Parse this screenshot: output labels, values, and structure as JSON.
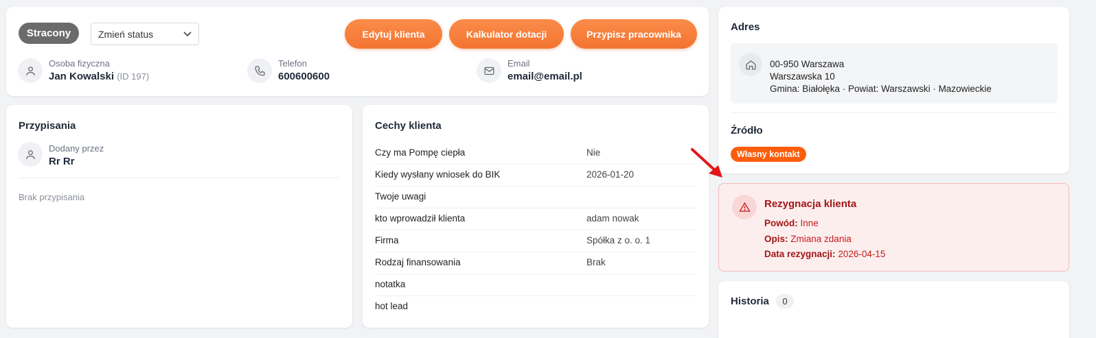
{
  "header": {
    "status_label": "Stracony",
    "status_select_value": "Zmień status",
    "buttons": {
      "edit": "Edytuj klienta",
      "calculator": "Kalkulator dotacji",
      "assign": "Przypisz pracownika"
    },
    "person": {
      "label": "Osoba fizyczna",
      "name": "Jan Kowalski",
      "id_text": "(ID 197)"
    },
    "phone": {
      "label": "Telefon",
      "value": "600600600"
    },
    "email": {
      "label": "Email",
      "value": "email@email.pl"
    }
  },
  "assignments": {
    "title": "Przypisania",
    "added_by_label": "Dodany przez",
    "added_by_value": "Rr Rr",
    "empty_text": "Brak przypisania"
  },
  "features": {
    "title": "Cechy klienta",
    "rows": [
      {
        "label": "Czy ma Pompę ciepła",
        "value": "Nie"
      },
      {
        "label": "Kiedy wysłany wniosek do BIK",
        "value": "2026-01-20"
      },
      {
        "label": "Twoje uwagi",
        "value": ""
      },
      {
        "label": "kto wprowadził klienta",
        "value": "adam nowak"
      },
      {
        "label": "Firma",
        "value": "Spółka z o. o. 1"
      },
      {
        "label": "Rodzaj finansowania",
        "value": "Brak"
      },
      {
        "label": "notatka",
        "value": ""
      },
      {
        "label": "hot lead",
        "value": ""
      }
    ]
  },
  "address": {
    "title": "Adres",
    "line1": "00-950 Warszawa",
    "line2": "Warszawska 10",
    "line3": "Gmina: Białołęka · Powiat: Warszawski · Mazowieckie"
  },
  "source": {
    "title": "Źródło",
    "badge": "Własny kontakt"
  },
  "resignation": {
    "title": "Rezygnacja klienta",
    "reason_label": "Powód:",
    "reason_value": "Inne",
    "desc_label": "Opis:",
    "desc_value": "Zmiana zdania",
    "date_label": "Data rezygnacji:",
    "date_value": "2026-04-15"
  },
  "history": {
    "title": "Historia",
    "count": "0"
  },
  "colors": {
    "accent": "#f27430",
    "status_gray": "#6b6b6b",
    "alert_red": "#c31b1b",
    "badge_orange": "#fb5d0b"
  },
  "icons": {
    "person": "user-icon",
    "phone": "phone-icon",
    "email": "mail-icon",
    "home": "home-icon",
    "warning": "warning-icon",
    "dropdown": "chevron-down-icon"
  }
}
